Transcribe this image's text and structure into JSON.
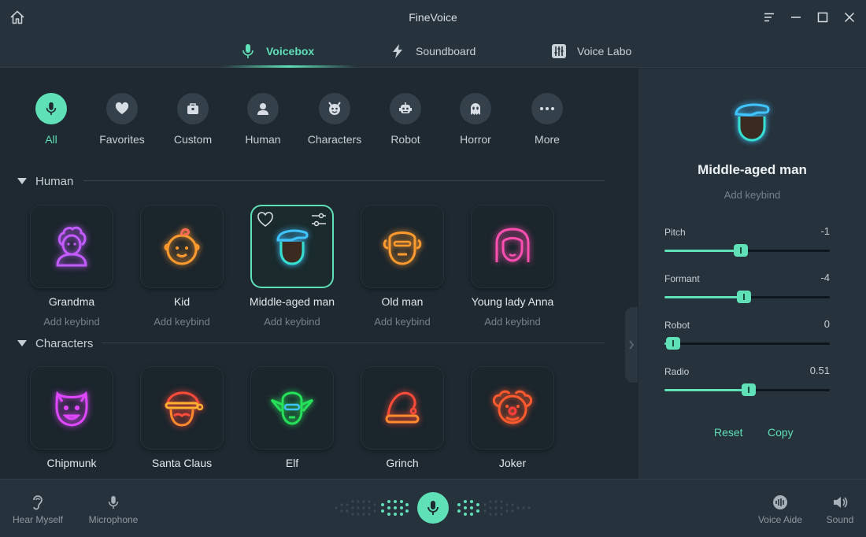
{
  "titlebar": {
    "title": "FineVoice"
  },
  "tabs": [
    {
      "label": "Voicebox",
      "icon": "microphone-icon",
      "active": true
    },
    {
      "label": "Soundboard",
      "icon": "lightning-icon",
      "active": false
    },
    {
      "label": "Voice Labo",
      "icon": "equalizer-icon",
      "active": false
    }
  ],
  "categories": [
    {
      "label": "All",
      "icon": "microphone-icon",
      "active": true
    },
    {
      "label": "Favorites",
      "icon": "heart-icon"
    },
    {
      "label": "Custom",
      "icon": "briefcase-icon"
    },
    {
      "label": "Human",
      "icon": "person-icon"
    },
    {
      "label": "Characters",
      "icon": "devil-face-icon"
    },
    {
      "label": "Robot",
      "icon": "robot-icon"
    },
    {
      "label": "Horror",
      "icon": "ghost-icon"
    },
    {
      "label": "More",
      "icon": "more-dots-icon"
    }
  ],
  "sections": {
    "human": {
      "title": "Human",
      "voices": [
        {
          "name": "Grandma",
          "keybind": "Add keybind",
          "icon": "grandma-icon",
          "color": "#c35bff"
        },
        {
          "name": "Kid",
          "keybind": "Add keybind",
          "icon": "kid-icon",
          "color": "#ff9a2e"
        },
        {
          "name": "Middle-aged man",
          "keybind": "Add keybind",
          "icon": "middle-aged-man-icon",
          "color": "#3fc4ff",
          "selected": true
        },
        {
          "name": "Old man",
          "keybind": "Add keybind",
          "icon": "old-man-icon",
          "color": "#ff9a2e"
        },
        {
          "name": "Young lady Anna",
          "keybind": "Add keybind",
          "icon": "young-lady-icon",
          "color": "#ff4fb0"
        }
      ]
    },
    "characters": {
      "title": "Characters",
      "voices": [
        {
          "name": "Chipmunk",
          "icon": "chipmunk-icon",
          "color": "#e048ff"
        },
        {
          "name": "Santa Claus",
          "icon": "santa-icon",
          "color": "#ff4b3a"
        },
        {
          "name": "Elf",
          "icon": "elf-icon",
          "color": "#27e05a"
        },
        {
          "name": "Grinch",
          "icon": "grinch-hat-icon",
          "color": "#ff4b3a"
        },
        {
          "name": "Joker",
          "icon": "joker-icon",
          "color": "#ff5a2e"
        }
      ]
    }
  },
  "side_panel": {
    "voice_name": "Middle-aged man",
    "keybind": "Add keybind",
    "params": [
      {
        "label": "Pitch",
        "value": "-1",
        "fraction": 0.46
      },
      {
        "label": "Formant",
        "value": "-4",
        "fraction": 0.48
      },
      {
        "label": "Robot",
        "value": "0",
        "fraction": 0.05
      },
      {
        "label": "Radio",
        "value": "0.51",
        "fraction": 0.51
      }
    ],
    "reset_label": "Reset",
    "copy_label": "Copy"
  },
  "bottombar": {
    "hear_myself": "Hear Myself",
    "microphone": "Microphone",
    "voice_aide": "Voice Aide",
    "sound": "Sound"
  },
  "colors": {
    "accent": "#5fe0b6",
    "bg": "#1e2931",
    "panel": "#26323c"
  }
}
